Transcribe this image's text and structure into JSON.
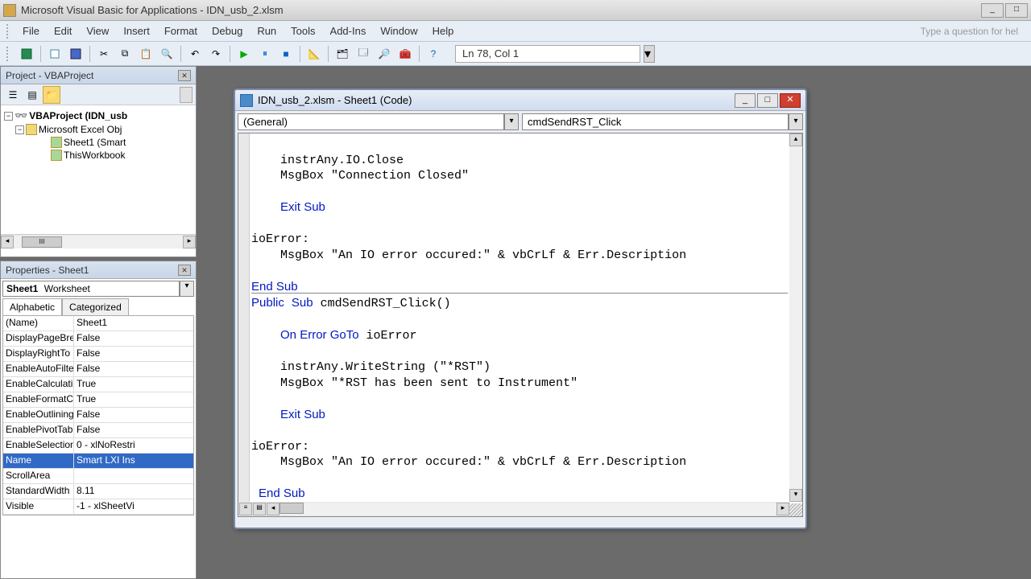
{
  "app": {
    "title": "Microsoft Visual Basic for Applications - IDN_usb_2.xlsm",
    "question_hint": "Type a question for hel"
  },
  "menu": {
    "file": "File",
    "edit": "Edit",
    "view": "View",
    "insert": "Insert",
    "format": "Format",
    "debug": "Debug",
    "run": "Run",
    "tools": "Tools",
    "addins": "Add-Ins",
    "window": "Window",
    "help": "Help"
  },
  "toolbar": {
    "cursor_pos": "Ln 78, Col 1"
  },
  "project": {
    "title": "Project - VBAProject",
    "root": "VBAProject (IDN_usb",
    "folder": "Microsoft Excel Obj",
    "sheet1": "Sheet1 (Smart",
    "thiswb": "ThisWorkbook"
  },
  "props": {
    "title": "Properties - Sheet1",
    "object_name": "Sheet1",
    "object_type": "Worksheet",
    "tab_alpha": "Alphabetic",
    "tab_cat": "Categorized",
    "rows": [
      {
        "n": "(Name)",
        "v": "Sheet1"
      },
      {
        "n": "DisplayPageBre",
        "v": "False"
      },
      {
        "n": "DisplayRightTo",
        "v": "False"
      },
      {
        "n": "EnableAutoFilte",
        "v": "False"
      },
      {
        "n": "EnableCalculati",
        "v": "True"
      },
      {
        "n": "EnableFormatC",
        "v": "True"
      },
      {
        "n": "EnableOutlining",
        "v": "False"
      },
      {
        "n": "EnablePivotTab",
        "v": "False"
      },
      {
        "n": "EnableSelection",
        "v": "0 - xlNoRestri"
      },
      {
        "n": "Name",
        "v": "Smart LXI Ins"
      },
      {
        "n": "ScrollArea",
        "v": ""
      },
      {
        "n": "StandardWidth",
        "v": "8.11"
      },
      {
        "n": "Visible",
        "v": "-1 - xlSheetVi"
      }
    ],
    "selected_index": 9
  },
  "codewin": {
    "title": "IDN_usb_2.xlsm - Sheet1 (Code)",
    "combo_left": "(General)",
    "combo_right": "cmdSendRST_Click",
    "lines": [
      {
        "t": "",
        "k": ""
      },
      {
        "t": "    instrAny.IO.Close",
        "k": ""
      },
      {
        "t": "    MsgBox \"Connection Closed\"",
        "k": ""
      },
      {
        "t": "",
        "k": ""
      },
      {
        "t": "    Exit Sub",
        "k": "Exit Sub"
      },
      {
        "t": "",
        "k": ""
      },
      {
        "t": "ioError:",
        "k": ""
      },
      {
        "t": "    MsgBox \"An IO error occured:\" & vbCrLf & Err.Description",
        "k": ""
      },
      {
        "t": "",
        "k": ""
      },
      {
        "t": "End Sub",
        "k": "End Sub"
      },
      {
        "t": "Public Sub cmdSendRST_Click()",
        "k": "Public Sub"
      },
      {
        "t": "",
        "k": ""
      },
      {
        "t": "    On Error GoTo ioError",
        "k": "On Error GoTo"
      },
      {
        "t": "",
        "k": ""
      },
      {
        "t": "    instrAny.WriteString (\"*RST\")",
        "k": ""
      },
      {
        "t": "    MsgBox \"*RST has been sent to Instrument\"",
        "k": ""
      },
      {
        "t": "",
        "k": ""
      },
      {
        "t": "    Exit Sub",
        "k": "Exit Sub"
      },
      {
        "t": "",
        "k": ""
      },
      {
        "t": "ioError:",
        "k": ""
      },
      {
        "t": "    MsgBox \"An IO error occured:\" & vbCrLf & Err.Description",
        "k": ""
      },
      {
        "t": "",
        "k": ""
      },
      {
        "t": " End Sub",
        "k": "End Sub"
      }
    ]
  }
}
